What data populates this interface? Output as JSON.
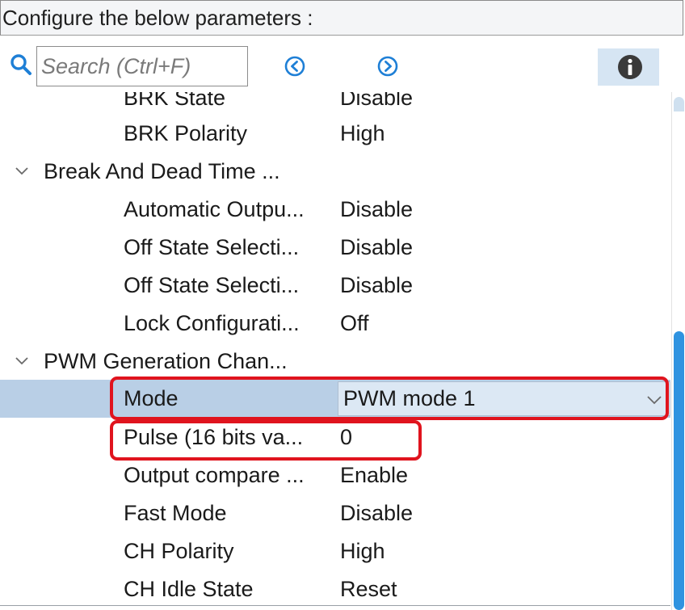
{
  "header": {
    "title": "Configure the below parameters :"
  },
  "search": {
    "placeholder": "Search (Ctrl+F)",
    "value": ""
  },
  "colors": {
    "accent": "#2f93e0",
    "selection": "#b9cfe6",
    "highlight": "#e0141e",
    "info_bg": "#d6e5f3"
  },
  "icons": {
    "search": "search-icon",
    "previous": "chevron-left-circle-icon",
    "next": "chevron-right-circle-icon",
    "info": "info-icon",
    "expand": "chevron-down-icon",
    "dropdown": "chevron-down-icon"
  },
  "rows": {
    "brk_state": {
      "param": "BRK State",
      "value": "Disable"
    },
    "brk_polarity": {
      "param": "BRK Polarity",
      "value": "High"
    },
    "group_break": {
      "title": "Break And Dead Time ..."
    },
    "auto_output": {
      "param": "Automatic Outpu...",
      "value": "Disable"
    },
    "off_state_1": {
      "param": "Off State Selecti...",
      "value": "Disable"
    },
    "off_state_2": {
      "param": "Off State Selecti...",
      "value": "Disable"
    },
    "lock_config": {
      "param": "Lock Configurati...",
      "value": "Off"
    },
    "group_pwm": {
      "title": "PWM Generation Chan..."
    },
    "mode": {
      "param": "Mode",
      "value": "PWM mode 1"
    },
    "pulse": {
      "param": "Pulse (16 bits va...",
      "value": "0"
    },
    "output_compare": {
      "param": "Output compare ...",
      "value": "Enable"
    },
    "fast_mode": {
      "param": "Fast Mode",
      "value": "Disable"
    },
    "ch_polarity": {
      "param": "CH Polarity",
      "value": "High"
    },
    "ch_idle_state": {
      "param": "CH Idle State",
      "value": "Reset"
    }
  }
}
